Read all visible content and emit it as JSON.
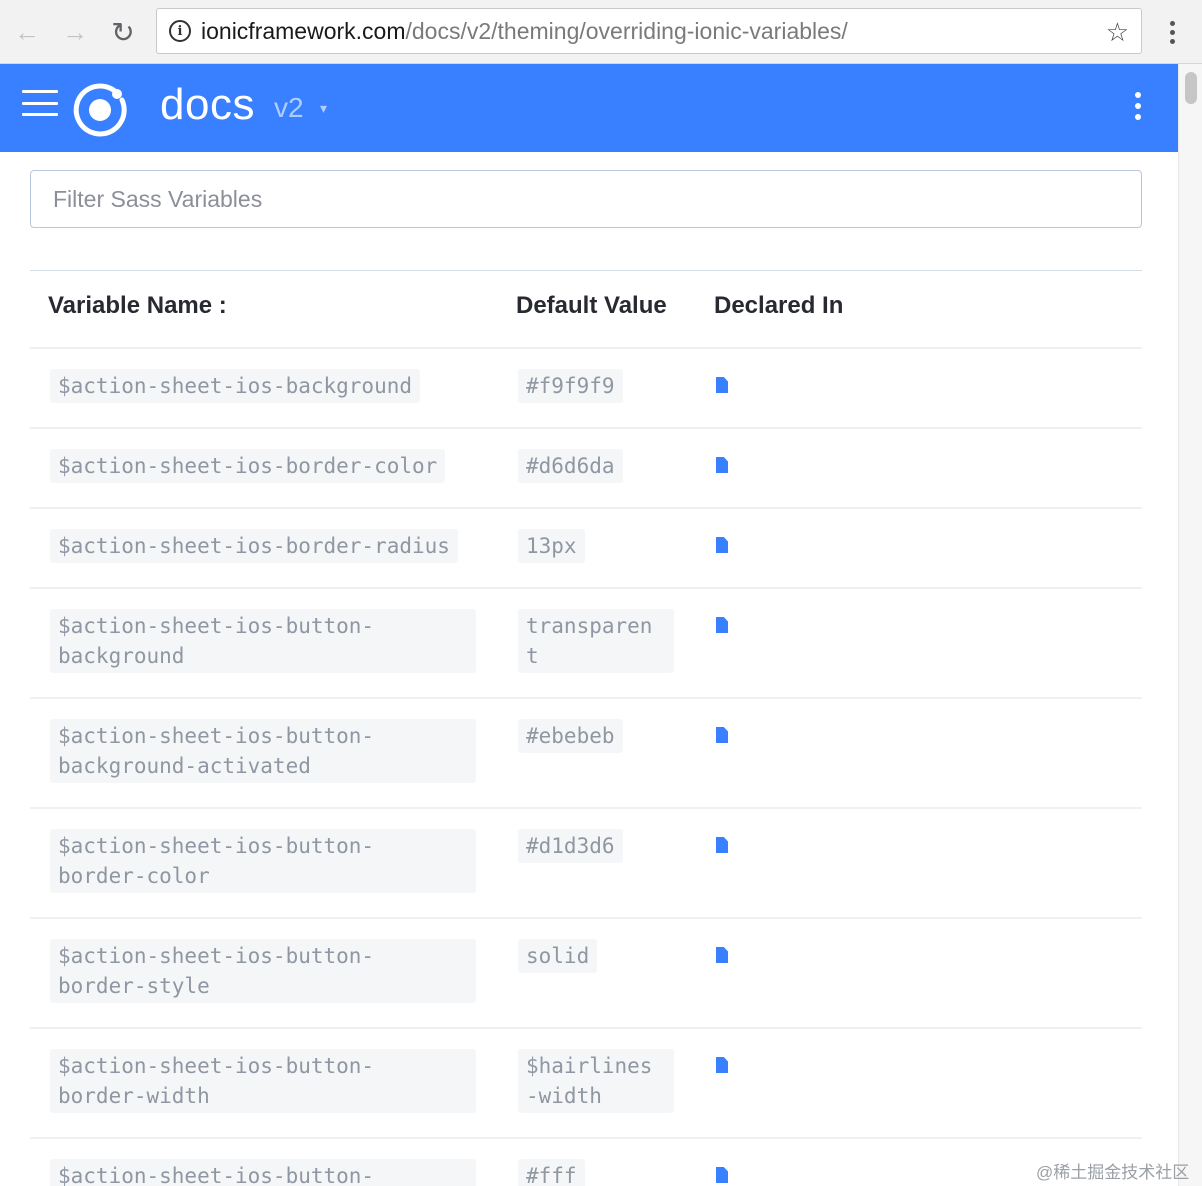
{
  "browser": {
    "url_domain": "ionicframework.com",
    "url_path": "/docs/v2/theming/overriding-ionic-variables/"
  },
  "header": {
    "title": "docs",
    "version": "v2",
    "brand_color": "#3880ff"
  },
  "filter": {
    "placeholder": "Filter Sass Variables"
  },
  "table": {
    "columns": [
      "Variable Name :",
      "Default Value",
      "Declared In"
    ],
    "rows": [
      {
        "name": "$action-sheet-ios-background",
        "default": "#f9f9f9",
        "declared_icon": "file-icon"
      },
      {
        "name": "$action-sheet-ios-border-color",
        "default": "#d6d6da",
        "declared_icon": "file-icon"
      },
      {
        "name": "$action-sheet-ios-border-radius",
        "default": "13px",
        "declared_icon": "file-icon"
      },
      {
        "name": "$action-sheet-ios-button-\nbackground",
        "default": "transparen\nt",
        "declared_icon": "file-icon"
      },
      {
        "name": "$action-sheet-ios-button-\nbackground-activated",
        "default": "#ebebeb",
        "declared_icon": "file-icon"
      },
      {
        "name": "$action-sheet-ios-button-\nborder-color",
        "default": "#d1d3d6",
        "declared_icon": "file-icon"
      },
      {
        "name": "$action-sheet-ios-button-\nborder-style",
        "default": "solid",
        "declared_icon": "file-icon"
      },
      {
        "name": "$action-sheet-ios-button-\nborder-width",
        "default": "$hairlines\n-width",
        "declared_icon": "file-icon"
      },
      {
        "name": "$action-sheet-ios-button-",
        "default": "#fff",
        "declared_icon": "file-icon"
      }
    ]
  },
  "watermark": "@稀土掘金技术社区"
}
